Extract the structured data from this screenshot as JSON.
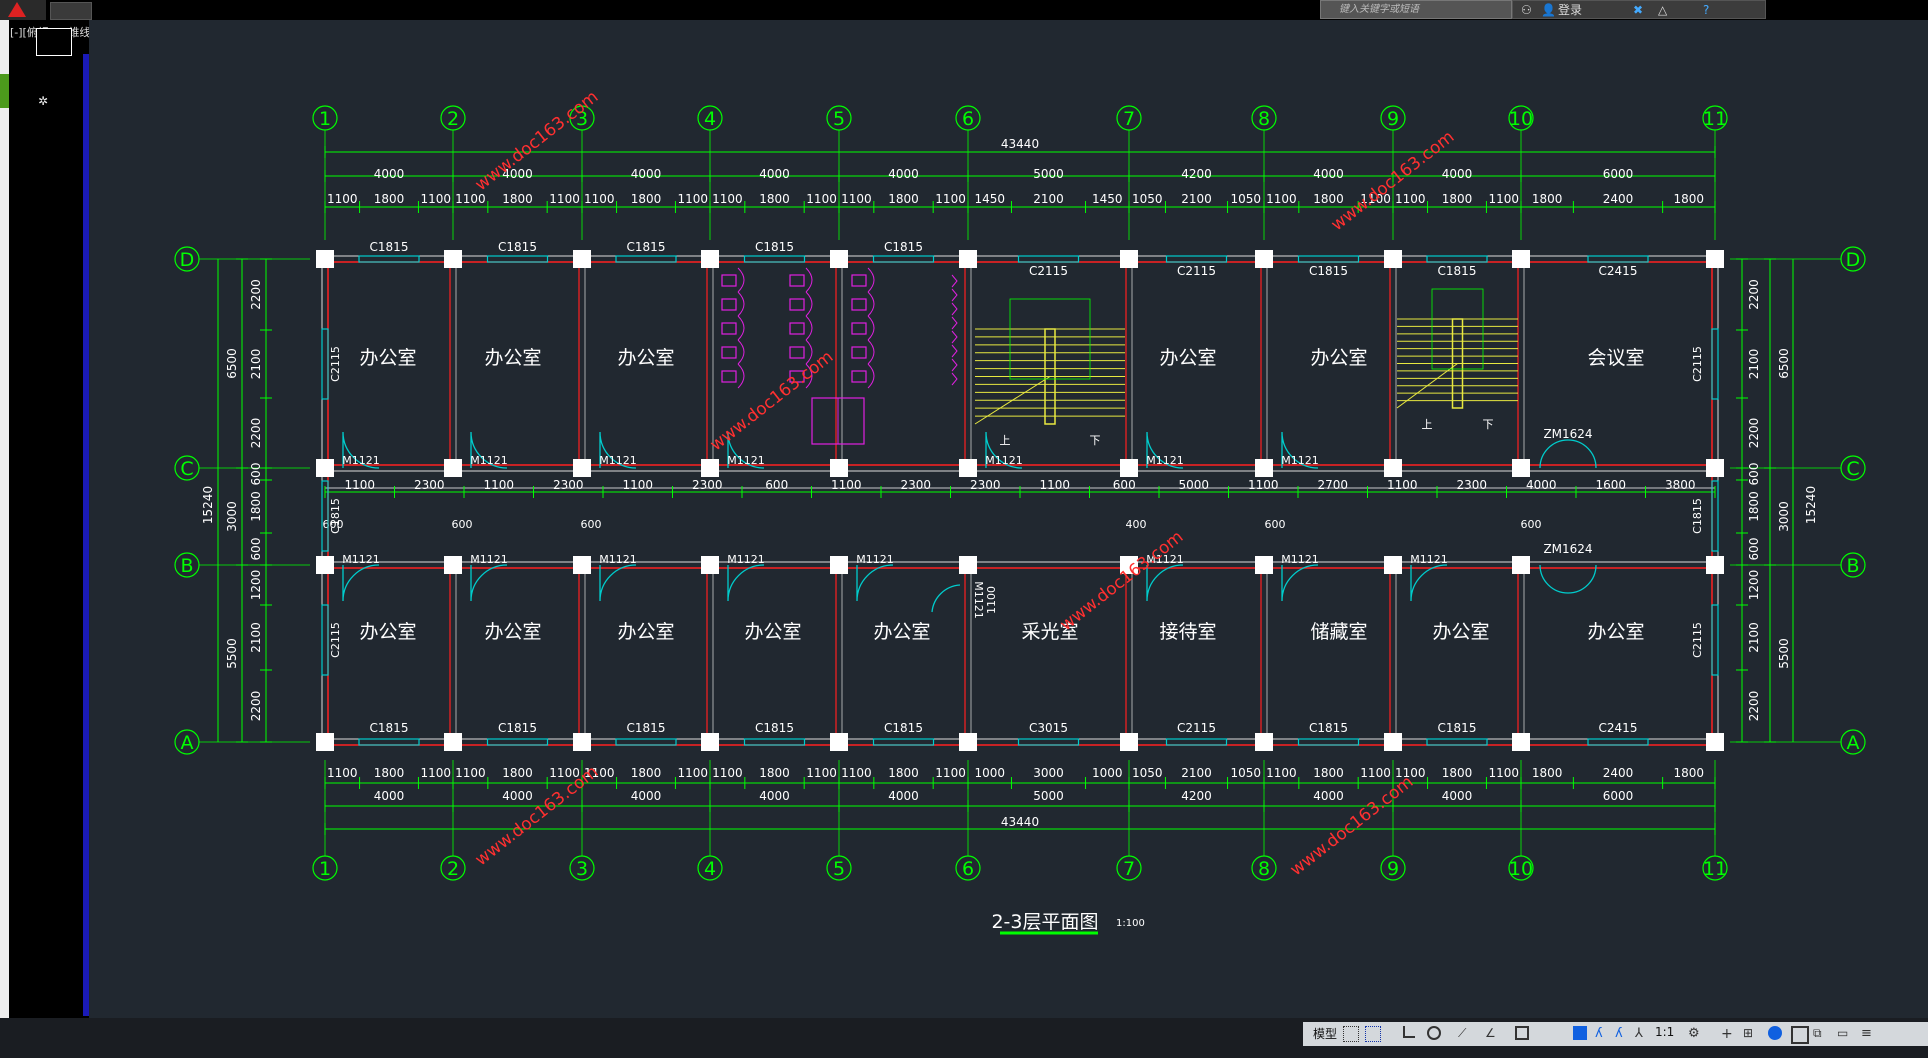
{
  "topbar": {
    "search_placeholder": "键入关键字或短语",
    "login_label": "登录"
  },
  "left_panel": {
    "view_label": "[-][俯视][二维线框]"
  },
  "drawing": {
    "title": "2-3层平面图",
    "scale": "1:100",
    "watermark": "www.doc163.com",
    "total_length": "43440",
    "total_width": "15240",
    "axis_numbers": [
      "1",
      "2",
      "3",
      "4",
      "5",
      "6",
      "7",
      "8",
      "9",
      "10",
      "11"
    ],
    "axis_letters": [
      "D",
      "C",
      "B",
      "A"
    ],
    "bay_dims": [
      "4000",
      "4000",
      "4000",
      "4000",
      "4000",
      "5000",
      "4200",
      "4000",
      "4000",
      "6000"
    ],
    "top_detail_dims": [
      "1100",
      "1800",
      "1100",
      "1100",
      "1800",
      "1100",
      "1100",
      "1800",
      "1100",
      "1100",
      "1800",
      "1100",
      "1100",
      "1800",
      "1100",
      "1450",
      "2100",
      "1450",
      "1050",
      "2100",
      "1050",
      "1100",
      "1800",
      "1100",
      "1100",
      "1800",
      "1100",
      "1800",
      "2400",
      "1800"
    ],
    "bottom_detail_dims": [
      "1100",
      "1800",
      "1100",
      "1100",
      "1800",
      "1100",
      "1100",
      "1800",
      "1100",
      "1100",
      "1800",
      "1100",
      "1100",
      "1800",
      "1100",
      "1000",
      "3000",
      "1000",
      "1050",
      "2100",
      "1050",
      "1100",
      "1800",
      "1100",
      "1100",
      "1800",
      "1100",
      "1800",
      "2400",
      "1800"
    ],
    "corridor_dims": [
      "1100",
      "2300",
      "1100",
      "2300",
      "1100",
      "2300",
      "600",
      "1100",
      "2300",
      "2300",
      "1100",
      "600",
      "5000",
      "1100",
      "2700",
      "1100",
      "2300",
      "4000",
      "1600",
      "3800"
    ],
    "left_dims_outer": [
      "6500",
      "3000",
      "5500"
    ],
    "left_dims_inner": [
      "2200",
      "2100",
      "2200",
      "600",
      "1800",
      "600",
      "1200",
      "2100",
      "2200"
    ],
    "windows_top": [
      "C1815",
      "C1815",
      "C1815",
      "C1815",
      "C1815",
      "C2115",
      "C2115",
      "C1815",
      "C1815",
      "C2415"
    ],
    "windows_bottom": [
      "C1815",
      "C1815",
      "C1815",
      "C1815",
      "C1815",
      "C3015",
      "C2115",
      "C1815",
      "C1815",
      "C2415"
    ],
    "side_windows": [
      "C2115",
      "C1815",
      "C2115"
    ],
    "doors": [
      "M1121",
      "ZM1624"
    ],
    "rooms_north": [
      "办公室",
      "办公室",
      "办公室",
      "办公室",
      "办公室",
      "会议室"
    ],
    "rooms_south": [
      "办公室",
      "办公室",
      "办公室",
      "办公室",
      "办公室",
      "采光室",
      "接待室",
      "储藏室",
      "办公室",
      "办公室"
    ],
    "stair_labels": [
      "上",
      "下"
    ],
    "door_dim": "1100",
    "corridor_small": [
      "600",
      "600",
      "600",
      "400",
      "600",
      "600"
    ]
  },
  "statusbar": {
    "model_label": "模型",
    "scale_label": "1:1"
  },
  "colors": {
    "canvas": "#212830",
    "axis_green": "#00ff00",
    "wall_red": "#ff2020",
    "door_cyan": "#00cccc",
    "toilet_magenta": "#e020e0",
    "stair_yellow": "#e8e840",
    "watermark_red": "#ff3030"
  }
}
